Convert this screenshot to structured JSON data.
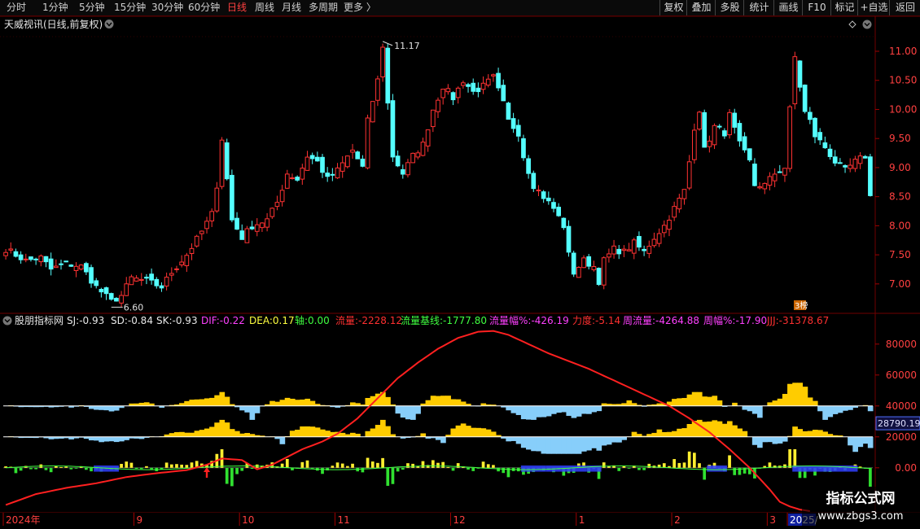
{
  "toolbar": {
    "periods": [
      "分时",
      "1分钟",
      "5分钟",
      "15分钟",
      "30分钟",
      "60分钟",
      "日线",
      "周线",
      "月线",
      "多周期",
      "更多 〉"
    ],
    "active_period": "日线",
    "right_buttons": [
      "复权",
      "叠加",
      "多股",
      "统计",
      "画线",
      "F10",
      "标记",
      "+自选",
      "返回"
    ]
  },
  "main_panel": {
    "title": "天威视讯(日线,前复权)",
    "high_label": "11.17",
    "low_label": "6.60",
    "price_ticks": [
      "11.00",
      "10.50",
      "10.00",
      "9.50",
      "9.00",
      "8.50",
      "8.00",
      "7.50",
      "7.00"
    ],
    "badge": "3榜"
  },
  "indicator_panel": {
    "name": "股朋指标网",
    "stats": [
      {
        "label": "SJ:",
        "value": "-0.93",
        "color": "#e8e8e8"
      },
      {
        "label": "SD:",
        "value": "-0.84",
        "color": "#e8e8e8"
      },
      {
        "label": "SK:",
        "value": "-0.93",
        "color": "#e8e8e8"
      },
      {
        "label": "DIF:",
        "value": "-0.22",
        "color": "#ff40ff"
      },
      {
        "label": "DEA:",
        "value": "0.17",
        "color": "#ffff40"
      },
      {
        "label": "轴:",
        "value": "0.00",
        "color": "#40ff40"
      },
      {
        "label": "流量:",
        "value": "-2228.12",
        "color": "#ff3030"
      },
      {
        "label": "流量基线:",
        "value": "-1777.80",
        "color": "#40ff40"
      },
      {
        "label": "流量幅%:",
        "value": "-426.19",
        "color": "#ff40ff"
      },
      {
        "label": "力度:",
        "value": "-5.14",
        "color": "#ff3030"
      },
      {
        "label": "周流量:",
        "value": "-4264.88",
        "color": "#ff40ff"
      },
      {
        "label": "周幅%:",
        "value": "-17.90",
        "color": "#ff40ff"
      },
      {
        "label": "JJJ:",
        "value": "-31378.67",
        "color": "#ff3030"
      }
    ],
    "ticks": [
      "80000",
      "60000",
      "40000",
      "20000",
      "0.00"
    ],
    "current_value": "28790.19"
  },
  "time_axis": {
    "labels": [
      "2024年",
      "9",
      "10",
      "11",
      "12",
      "1",
      "2",
      "3",
      "2025/"
    ]
  },
  "watermark": {
    "line1": "指标公式网",
    "line2": "www.zbgs3.com"
  },
  "chart_data": {
    "type": "candlestick",
    "title": "天威视讯(日线,前复权)",
    "ylim": [
      6.55,
      11.35
    ],
    "indicator_ylim": [
      -28000,
      92000
    ],
    "y_ticks": [
      7.0,
      7.5,
      8.0,
      8.5,
      9.0,
      9.5,
      10.0,
      10.5,
      11.0
    ],
    "indicator_ticks": [
      80000,
      60000,
      40000,
      20000,
      0
    ],
    "x_month_labels": [
      "2024年",
      "9",
      "10",
      "11",
      "12",
      "1",
      "2",
      "3",
      "2025/"
    ],
    "x_month_label_bars": [
      0,
      26,
      47,
      66,
      89,
      114,
      133,
      152,
      156
    ],
    "annotated_high": 11.17,
    "annotated_low": 6.6,
    "anchors": [
      [
        0,
        7.6
      ],
      [
        4,
        7.4
      ],
      [
        7,
        7.45
      ],
      [
        9,
        7.25
      ],
      [
        12,
        7.35
      ],
      [
        15,
        7.3
      ],
      [
        18,
        6.95
      ],
      [
        21,
        6.7
      ],
      [
        23,
        6.8
      ],
      [
        25,
        7.1
      ],
      [
        28,
        7.05
      ],
      [
        31,
        6.95
      ],
      [
        33,
        7.2
      ],
      [
        36,
        7.5
      ],
      [
        39,
        7.9
      ],
      [
        41,
        8.2
      ],
      [
        42,
        8.7
      ],
      [
        43,
        9.5
      ],
      [
        45,
        8.1
      ],
      [
        47,
        7.8
      ],
      [
        49,
        8.0
      ],
      [
        52,
        8.1
      ],
      [
        54,
        8.4
      ],
      [
        56,
        8.9
      ],
      [
        58,
        8.8
      ],
      [
        60,
        9.2
      ],
      [
        62,
        9.1
      ],
      [
        64,
        8.8
      ],
      [
        66,
        8.95
      ],
      [
        69,
        9.3
      ],
      [
        71,
        9.0
      ],
      [
        72,
        9.8
      ],
      [
        74,
        10.5
      ],
      [
        75,
        11.1
      ],
      [
        76,
        10.1
      ],
      [
        77,
        9.2
      ],
      [
        79,
        8.9
      ],
      [
        81,
        9.2
      ],
      [
        83,
        9.4
      ],
      [
        85,
        10.0
      ],
      [
        87,
        10.4
      ],
      [
        89,
        10.2
      ],
      [
        91,
        10.5
      ],
      [
        93,
        10.3
      ],
      [
        95,
        10.4
      ],
      [
        97,
        10.55
      ],
      [
        99,
        10.1
      ],
      [
        100,
        9.8
      ],
      [
        102,
        9.6
      ],
      [
        103,
        9.2
      ],
      [
        105,
        8.7
      ],
      [
        107,
        8.5
      ],
      [
        109,
        8.3
      ],
      [
        111,
        8.0
      ],
      [
        112,
        7.5
      ],
      [
        113,
        7.2
      ],
      [
        115,
        7.4
      ],
      [
        117,
        7.3
      ],
      [
        118,
        7.05
      ],
      [
        119,
        7.4
      ],
      [
        121,
        7.6
      ],
      [
        123,
        7.55
      ],
      [
        125,
        7.7
      ],
      [
        127,
        7.55
      ],
      [
        129,
        7.8
      ],
      [
        131,
        8.0
      ],
      [
        133,
        8.3
      ],
      [
        135,
        8.6
      ],
      [
        136,
        9.1
      ],
      [
        137,
        9.7
      ],
      [
        138,
        10.0
      ],
      [
        139,
        9.3
      ],
      [
        141,
        9.7
      ],
      [
        143,
        9.6
      ],
      [
        144,
        9.9
      ],
      [
        146,
        9.4
      ],
      [
        148,
        9.1
      ],
      [
        149,
        8.7
      ],
      [
        151,
        8.7
      ],
      [
        153,
        8.9
      ],
      [
        155,
        9.0
      ],
      [
        156,
        10.0
      ],
      [
        157,
        10.9
      ],
      [
        158,
        10.4
      ],
      [
        159,
        9.95
      ],
      [
        160,
        9.8
      ],
      [
        161,
        9.55
      ],
      [
        163,
        9.35
      ],
      [
        165,
        9.1
      ],
      [
        167,
        8.95
      ],
      [
        169,
        9.1
      ],
      [
        171,
        9.2
      ],
      [
        172,
        8.5
      ]
    ],
    "series": [
      {
        "name": "JJJ",
        "color": "#ff2020",
        "anchors": [
          [
            0,
            -24000
          ],
          [
            6,
            -17000
          ],
          [
            12,
            -13000
          ],
          [
            18,
            -10000
          ],
          [
            24,
            -6000
          ],
          [
            30,
            -3500
          ],
          [
            36,
            -1500
          ],
          [
            40,
            2000
          ],
          [
            43,
            6000
          ],
          [
            47,
            5000
          ],
          [
            50,
            -1000
          ],
          [
            53,
            2000
          ],
          [
            56,
            7000
          ],
          [
            59,
            12000
          ],
          [
            63,
            17000
          ],
          [
            66,
            22000
          ],
          [
            70,
            32000
          ],
          [
            74,
            45000
          ],
          [
            78,
            58000
          ],
          [
            82,
            68000
          ],
          [
            86,
            77000
          ],
          [
            90,
            84000
          ],
          [
            94,
            88000
          ],
          [
            97,
            88500
          ],
          [
            100,
            86000
          ],
          [
            104,
            80000
          ],
          [
            108,
            74000
          ],
          [
            112,
            69000
          ],
          [
            116,
            64000
          ],
          [
            120,
            58000
          ],
          [
            124,
            52000
          ],
          [
            128,
            46000
          ],
          [
            132,
            40000
          ],
          [
            136,
            32000
          ],
          [
            140,
            23000
          ],
          [
            144,
            12000
          ],
          [
            148,
            0
          ],
          [
            152,
            -14000
          ],
          [
            154,
            -22000
          ],
          [
            156,
            -25000
          ],
          [
            158,
            -27000
          ],
          [
            160,
            -28000
          ]
        ]
      },
      {
        "name": "upper_band",
        "color": "#ffcc00",
        "ylevel": 40000,
        "color_neg": "#87cefa"
      },
      {
        "name": "lower_band",
        "color": "#ffcc00",
        "ylevel": 20000,
        "color_neg": "#87cefa"
      }
    ]
  }
}
